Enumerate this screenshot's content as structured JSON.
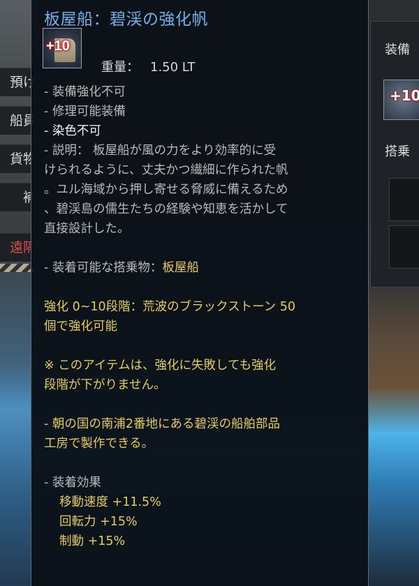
{
  "left_menu": {
    "items": [
      {
        "label": "預け",
        "color": "normal"
      },
      {
        "label": "船員",
        "color": "normal"
      },
      {
        "label": "貨物",
        "color": "normal"
      },
      {
        "label": "補",
        "color": "normal"
      },
      {
        "label": "遠隔",
        "color": "red"
      }
    ]
  },
  "right_panel": {
    "label_top": "装備",
    "label_mid": "搭乗",
    "icon_badge": "+10"
  },
  "tooltip": {
    "title": "板屋船：碧渓の強化帆",
    "enhance_badge": "+10",
    "weight_label": "重量：",
    "weight_value": "1.50 LT",
    "flags": [
      "- 装備強化不可",
      "- 修理可能装備",
      "- 染色不可"
    ],
    "description": [
      "- 説明： 板屋船が風の力をより効率的に受",
      "けられるように、丈夫かつ繊細に作られた帆",
      "。ユル海域から押し寄せる脅威に備えるため",
      "、碧渓島の儒生たちの経験や知恵を活かして",
      "直接設計した。"
    ],
    "equippable_label": "- 装着可能な搭乗物：",
    "equippable_value": "板屋船",
    "enhance_info": [
      "強化 0~10段階：荒波のブラックストーン 50",
      "個で強化可能"
    ],
    "note": [
      " ※ このアイテムは、強化に失敗しても強化",
      "段階が下がりません。"
    ],
    "craft_info": [
      "- 朝の国の南浦2番地にある碧渓の船舶部品",
      "工房で製作できる。"
    ],
    "effects_label": "- 装着効果",
    "effects": [
      "移動速度 +11.5%",
      "回転力 +15%",
      "制動 +15%"
    ]
  },
  "colors": {
    "title": "#6fb0ea",
    "yellow": "#e6cb5a",
    "white": "#f2f2f2",
    "gray": "#b9b9b9",
    "red_menu": "#e0504a"
  }
}
